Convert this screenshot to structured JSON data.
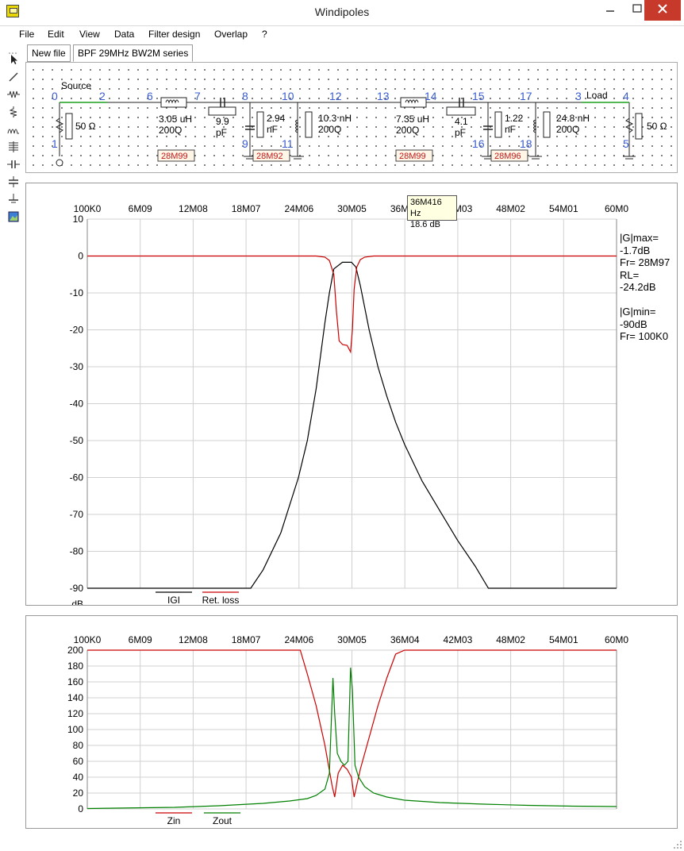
{
  "window": {
    "title": "Windipoles",
    "min_icon": "minimize-icon",
    "max_icon": "maximize-icon",
    "close_icon": "close-icon"
  },
  "menu": [
    "File",
    "Edit",
    "View",
    "Data",
    "Filter design",
    "Overlap",
    "?"
  ],
  "tabs": [
    "New file",
    "BPF 29MHz BW2M series"
  ],
  "tools": [
    "pointer-icon",
    "wire-icon",
    "resistor-icon",
    "inductor-icon",
    "transformer-icon",
    "coil-icon",
    "capacitor-icon",
    "capacitor-ground-icon",
    "ground-icon",
    "picture-icon"
  ],
  "schematic": {
    "nodes": [
      "0",
      "2",
      "6",
      "7",
      "8",
      "10",
      "12",
      "13",
      "14",
      "15",
      "17",
      "3",
      "4",
      "1",
      "9",
      "11",
      "16",
      "18",
      "5"
    ],
    "source_label": "Source",
    "load_label": "Load",
    "source_r": "50 Ω",
    "load_r": "50 Ω",
    "l1": [
      "3.05 uH",
      "200Q"
    ],
    "c1": [
      "9.9",
      "pF"
    ],
    "c2": [
      "2.94",
      "nF"
    ],
    "l2": [
      "10.3 nH",
      "200Q"
    ],
    "l3": [
      "7.35 uH",
      "200Q"
    ],
    "c3": [
      "4.1",
      "pF"
    ],
    "c4": [
      "1.22",
      "nF"
    ],
    "l4": [
      "24.8 nH",
      "200Q"
    ],
    "resonances": [
      "28M99",
      "28M92",
      "28M99",
      "28M96"
    ]
  },
  "tooltip": {
    "freq": "36M416 Hz",
    "value": "18.6 dB"
  },
  "stats": {
    "text": "|G|max=\n-1.7dB\nFr= 28M97\nRL=\n-24.2dB\n\n|G|min=\n-90dB\nFr= 100K0"
  },
  "chart_data": [
    {
      "type": "line",
      "x_ticks": [
        "100K0",
        "6M09",
        "12M08",
        "18M07",
        "24M06",
        "30M05",
        "36M04",
        "42M03",
        "48M02",
        "54M01",
        "60M0"
      ],
      "y_ticks": [
        "10",
        "0",
        "-10",
        "-20",
        "-30",
        "-40",
        "-50",
        "-60",
        "-70",
        "-80",
        "-90"
      ],
      "ylabel": "dB",
      "xlim": [
        0.1,
        60.0
      ],
      "ylim": [
        -90,
        10
      ],
      "grid": true,
      "series": [
        {
          "name": "IGI",
          "color": "#000000",
          "x": [
            0.1,
            18.6,
            20,
            22,
            24,
            25,
            26,
            27,
            27.5,
            28,
            28.97,
            29.5,
            30,
            30.5,
            31,
            32,
            33,
            34,
            35,
            36,
            38,
            40,
            42,
            44,
            45.5,
            60
          ],
          "y": [
            -90,
            -90,
            -85,
            -75,
            -60,
            -50,
            -36,
            -18,
            -10,
            -3.5,
            -1.7,
            -1.7,
            -1.7,
            -3,
            -8,
            -20,
            -30,
            -38,
            -45,
            -51,
            -61,
            -69,
            -77,
            -84,
            -90,
            -90
          ]
        },
        {
          "name": "Ret. loss",
          "color": "#cc0000",
          "x": [
            0.1,
            26,
            27,
            27.5,
            28,
            28.3,
            28.6,
            29,
            29.5,
            29.9,
            30.1,
            30.3,
            30.6,
            31,
            31.5,
            32.5,
            60
          ],
          "y": [
            0,
            0,
            -0.3,
            -1.2,
            -5,
            -15,
            -23,
            -24,
            -24.2,
            -26,
            -20,
            -9,
            -3,
            -1,
            -0.3,
            0,
            0
          ]
        }
      ]
    },
    {
      "type": "line",
      "x_ticks": [
        "100K0",
        "6M09",
        "12M08",
        "18M07",
        "24M06",
        "30M05",
        "36M04",
        "42M03",
        "48M02",
        "54M01",
        "60M0"
      ],
      "y_ticks": [
        "200",
        "180",
        "160",
        "140",
        "120",
        "100",
        "80",
        "60",
        "40",
        "20",
        "0"
      ],
      "xlim": [
        0.1,
        60.0
      ],
      "ylim": [
        0,
        200
      ],
      "grid": true,
      "series": [
        {
          "name": "Zin",
          "color": "#cc0000",
          "x": [
            0.1,
            24.2,
            25,
            26,
            27,
            27.8,
            28.1,
            28.5,
            29,
            29.5,
            30,
            30.3,
            31,
            32,
            33,
            34,
            35,
            36,
            60
          ],
          "y": [
            200,
            200,
            170,
            130,
            80,
            30,
            15,
            45,
            55,
            50,
            40,
            15,
            50,
            90,
            130,
            165,
            195,
            200,
            200
          ]
        },
        {
          "name": "Zout",
          "color": "#008000",
          "x": [
            0.1,
            10,
            15,
            20,
            23,
            25,
            26,
            27,
            27.5,
            27.9,
            28.1,
            28.4,
            28.8,
            29.2,
            29.6,
            29.9,
            30.1,
            30.4,
            30.8,
            31.5,
            32.5,
            34,
            36,
            40,
            45,
            50,
            55,
            60
          ],
          "y": [
            0.5,
            2,
            4,
            7,
            10,
            13,
            17,
            25,
            45,
            165,
            120,
            70,
            60,
            55,
            60,
            178,
            150,
            55,
            40,
            28,
            20,
            15,
            11,
            8,
            6,
            4.5,
            3.5,
            3
          ]
        }
      ]
    }
  ]
}
